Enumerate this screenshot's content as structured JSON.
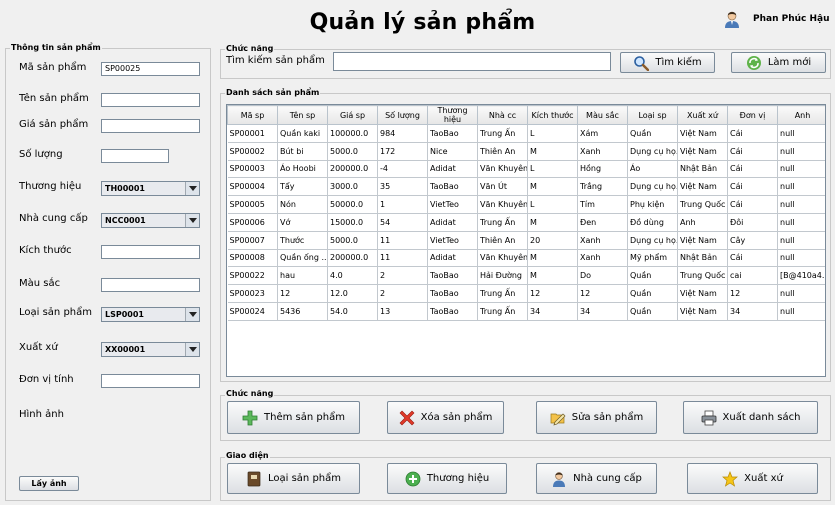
{
  "header": {
    "title": "Quản lý sản phẩm",
    "user_name": "Phan Phúc Hậu"
  },
  "info_panel": {
    "title": "Thông tin sản phẩm",
    "fields": {
      "ma_sp": {
        "label": "Mã sản phẩm",
        "value": "SP00025"
      },
      "ten_sp": {
        "label": "Tên sản phẩm",
        "value": ""
      },
      "gia_sp": {
        "label": "Giá sản phẩm",
        "value": ""
      },
      "so_luong": {
        "label": "Số lượng",
        "value": ""
      },
      "thuong_hieu": {
        "label": "Thương hiệu",
        "value": "TH00001"
      },
      "nha_cc": {
        "label": "Nhà cung cấp",
        "value": "NCC0001"
      },
      "kich_thuoc": {
        "label": "Kích thước",
        "value": ""
      },
      "mau_sac": {
        "label": "Màu sắc",
        "value": ""
      },
      "loai_sp": {
        "label": "Loại sản phẩm",
        "value": "LSP0001"
      },
      "xuat_xu": {
        "label": "Xuất xứ",
        "value": "XX00001"
      },
      "don_vi": {
        "label": "Đơn vị tính",
        "value": ""
      },
      "hinh_anh": {
        "label": "Hình ảnh"
      }
    },
    "get_image_button": "Lấy ảnh"
  },
  "search_panel": {
    "title": "Chức năng",
    "label": "Tìm kiếm sản phẩm",
    "value": "",
    "search_button": "Tìm kiếm",
    "refresh_button": "Làm mới"
  },
  "list_panel": {
    "title": "Danh sách sản phẩm",
    "columns": [
      "Mã sp",
      "Tên sp",
      "Giá sp",
      "Số lượng",
      "Thương hiệu",
      "Nhà cc",
      "Kích thước",
      "Màu sắc",
      "Loại sp",
      "Xuất xứ",
      "Đơn vị",
      "Anh"
    ],
    "rows": [
      [
        "SP00001",
        "Quần kaki",
        "100000.0",
        "984",
        "TaoBao",
        "Trung Ấn",
        "L",
        "Xám",
        "Quần",
        "Việt Nam",
        "Cái",
        "null"
      ],
      [
        "SP00002",
        "Bút bi",
        "5000.0",
        "172",
        "Nice",
        "Thiên An",
        "M",
        "Xanh",
        "Dụng cụ họ...",
        "Việt Nam",
        "Cái",
        "null"
      ],
      [
        "SP00003",
        "Áo Hoobi",
        "200000.0",
        "-4",
        "Adidat",
        "Văn Khuyên",
        "L",
        "Hồng",
        "Áo",
        "Nhật Bản",
        "Cái",
        "null"
      ],
      [
        "SP00004",
        "Tẩy",
        "3000.0",
        "35",
        "TaoBao",
        "Văn Út",
        "M",
        "Trắng",
        "Dụng cụ họ...",
        "Việt Nam",
        "Cái",
        "null"
      ],
      [
        "SP00005",
        "Nón",
        "50000.0",
        "1",
        "VietTeo",
        "Văn Khuyên",
        "L",
        "Tím",
        "Phụ kiện",
        "Trung Quốc",
        "Cái",
        "null"
      ],
      [
        "SP00006",
        "Vớ",
        "15000.0",
        "54",
        "Adidat",
        "Trung Ấn",
        "M",
        "Đen",
        "Đồ dùng",
        "Anh",
        "Đôi",
        "null"
      ],
      [
        "SP00007",
        "Thước",
        "5000.0",
        "11",
        "VietTeo",
        "Thiên An",
        "20",
        "Xanh",
        "Dụng cụ họ...",
        "Việt Nam",
        "Cây",
        "null"
      ],
      [
        "SP00008",
        "Quần ống ...",
        "200000.0",
        "11",
        "Adidat",
        "Văn Khuyên",
        "M",
        "Xanh",
        "Mỹ phẩm",
        "Nhật Bản",
        "Cái",
        "null"
      ],
      [
        "SP00022",
        "hau",
        "4.0",
        "2",
        "TaoBao",
        "Hải Đường",
        "M",
        "Do",
        "Quần",
        "Trung Quốc",
        "cai",
        "[B@410a4..."
      ],
      [
        "SP00023",
        "12",
        "12.0",
        "2",
        "TaoBao",
        "Trung Ấn",
        "12",
        "12",
        "Quần",
        "Việt Nam",
        "12",
        "null"
      ],
      [
        "SP00024",
        "5436",
        "54.0",
        "13",
        "TaoBao",
        "Trung Ấn",
        "34",
        "34",
        "Quần",
        "Việt Nam",
        "34",
        "null"
      ]
    ]
  },
  "action_panel": {
    "title": "Chức năng",
    "add": "Thêm sản phẩm",
    "delete": "Xóa sản phẩm",
    "edit": "Sửa sản phẩm",
    "export": "Xuất danh sách"
  },
  "nav_panel": {
    "title": "Giao diện",
    "category": "Loại sản phẩm",
    "brand": "Thương hiệu",
    "supplier": "Nhà cung cấp",
    "origin": "Xuất xứ"
  }
}
